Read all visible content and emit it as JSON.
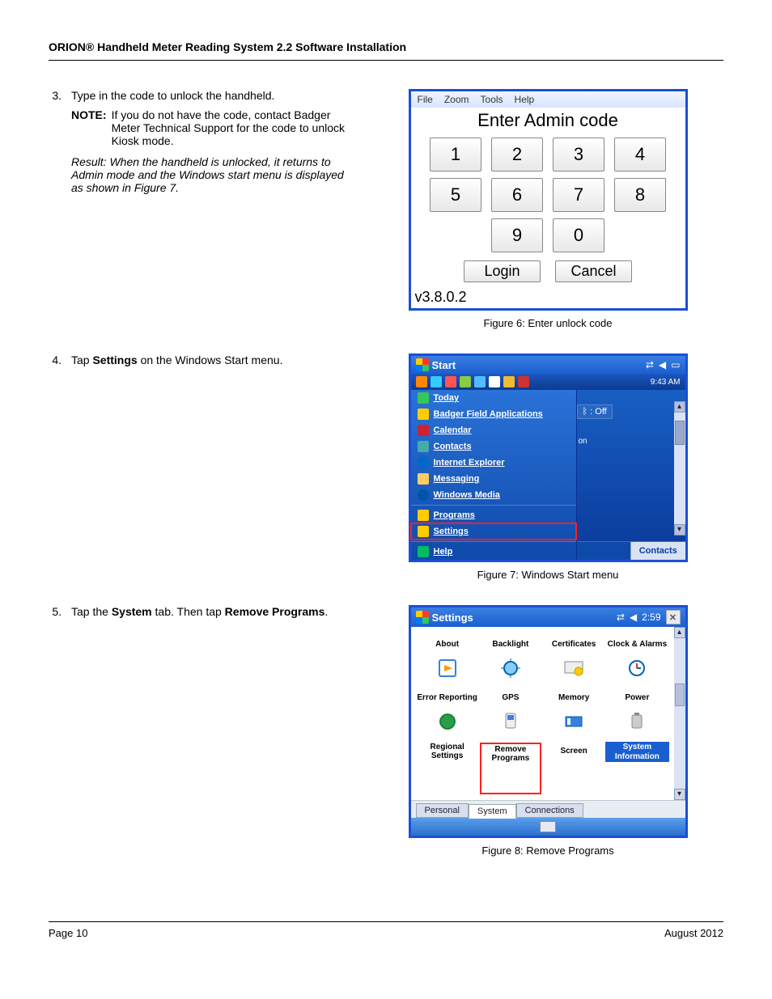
{
  "header": "ORION® Handheld Meter Reading System 2.2 Software Installation",
  "steps": {
    "s3": {
      "num": "3.",
      "text_a": "Type in the code to unlock the handheld.",
      "note_label": "NOTE:",
      "note_body": "If you do not have the code, contact Badger Meter Technical Support for the code to unlock Kiosk mode.",
      "result": "Result: When the handheld is unlocked, it returns to Admin mode and the Windows start menu is displayed as shown in Figure 7."
    },
    "s4": {
      "num": "4.",
      "text_a": "Tap ",
      "bold_a": "Settings",
      "text_b": " on the Windows Start menu."
    },
    "s5": {
      "num": "5.",
      "text_a": "Tap the ",
      "bold_a": "System",
      "text_b": " tab. Then tap ",
      "bold_b": "Remove Programs",
      "text_c": "."
    }
  },
  "fig6": {
    "menu": {
      "file": "File",
      "zoom": "Zoom",
      "tools": "Tools",
      "help": "Help"
    },
    "title": "Enter Admin code",
    "keys": [
      "1",
      "2",
      "3",
      "4",
      "5",
      "6",
      "7",
      "8",
      "",
      "9",
      "0",
      ""
    ],
    "login": "Login",
    "cancel": "Cancel",
    "version": "v3.8.0.2",
    "caption": "Figure 6:  Enter unlock code"
  },
  "fig7": {
    "start": "Start",
    "clock": "9:43 AM",
    "bt": "ᛒ : Off",
    "on": "on",
    "items": {
      "today": "Today",
      "badger": "Badger Field Applications",
      "calendar": "Calendar",
      "contacts": "Contacts",
      "ie": "Internet Explorer",
      "messaging": "Messaging",
      "wm": "Windows Media",
      "programs": "Programs",
      "settings": "Settings",
      "help": "Help"
    },
    "softkey_right": "Contacts",
    "caption": "Figure 7:  Windows Start menu"
  },
  "fig8": {
    "title": "Settings",
    "time": "2:59",
    "items": {
      "about": "About",
      "backlight": "Backlight",
      "certs": "Certificates",
      "clock": "Clock & Alarms",
      "error": "Error Reporting",
      "gps": "GPS",
      "memory": "Memory",
      "power": "Power",
      "regional": "Regional Settings",
      "remove": "Remove Programs",
      "screen": "Screen",
      "sysinfo": "System Information"
    },
    "tabs": {
      "personal": "Personal",
      "system": "System",
      "connections": "Connections"
    },
    "caption": "Figure 8:  Remove Programs"
  },
  "footer": {
    "left": "Page 10",
    "right": "August 2012"
  }
}
